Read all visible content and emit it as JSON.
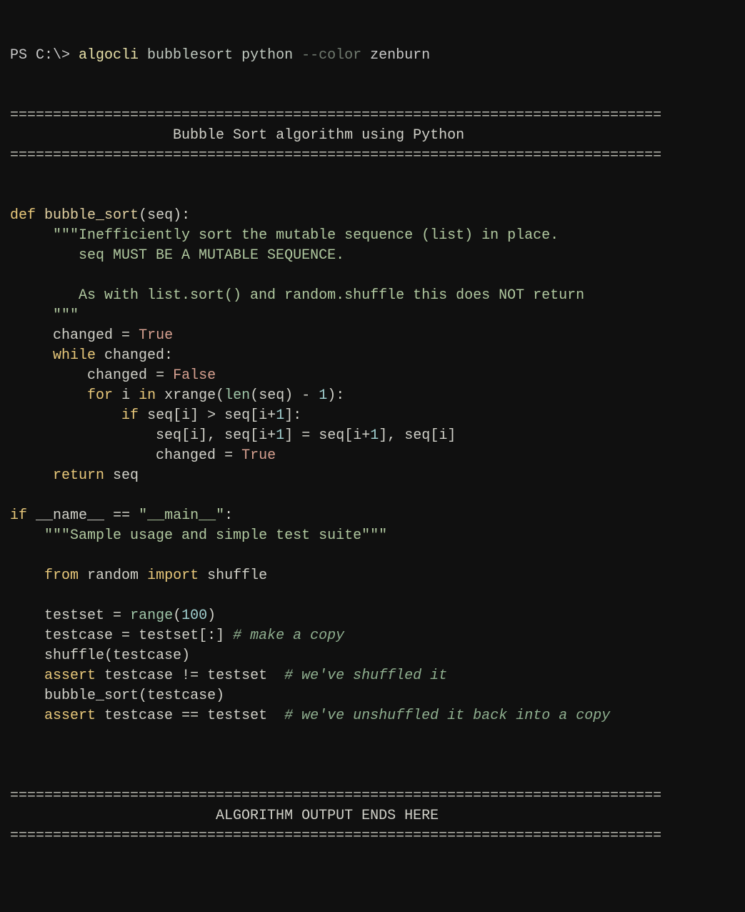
{
  "prompt": "PS C:\\> ",
  "cmd": "algocli",
  "arg1": "bubblesort",
  "arg2": "python",
  "flag": "--color",
  "flagval": "zenburn",
  "rule1": "============================================================================",
  "title": "Bubble Sort algorithm using Python",
  "rule2": "============================================================================",
  "code": {
    "def": "def",
    "fname": "bubble_sort",
    "param": "seq",
    "doc1": "\"\"\"Inefficiently sort the mutable sequence (list) in place.",
    "doc2": "seq MUST BE A MUTABLE SEQUENCE.",
    "doc3": "As with list.sort() and random.shuffle this does NOT return",
    "doc4": "\"\"\"",
    "l1a": "changed",
    "l1b": "=",
    "l1c": "True",
    "l2a": "while",
    "l2b": "changed:",
    "l3a": "changed",
    "l3b": "=",
    "l3c": "False",
    "l4a": "for",
    "l4b": "i",
    "l4c": "in",
    "l4d": "xrange",
    "l4e": "len",
    "l4f": "seq",
    "l4g": "1",
    "l5a": "if",
    "l5b": "seq",
    "l5c": "i",
    "l5d": "seq",
    "l5e": "i",
    "l5f": "1",
    "l6a": "seq",
    "l6b": "i",
    "l6c": "seq",
    "l6d": "i",
    "l6e": "1",
    "l6f": "seq",
    "l6g": "i",
    "l6h": "1",
    "l6i": "seq",
    "l6j": "i",
    "l7a": "changed",
    "l7b": "=",
    "l7c": "True",
    "l8a": "return",
    "l8b": "seq",
    "m1a": "if",
    "m1b": "__name__",
    "m1c": "==",
    "m1d": "\"__main__\"",
    "m2": "\"\"\"Sample usage and simple test suite\"\"\"",
    "m3a": "from",
    "m3b": "random",
    "m3c": "import",
    "m3d": "shuffle",
    "m4a": "testset",
    "m4b": "=",
    "m4c": "range",
    "m4d": "100",
    "m5a": "testcase",
    "m5b": "=",
    "m5c": "testset",
    "m5d": "# make a copy",
    "m6a": "shuffle",
    "m6b": "testcase",
    "m7a": "assert",
    "m7b": "testcase",
    "m7c": "!=",
    "m7d": "testset",
    "m7e": "# we've shuffled it",
    "m8a": "bubble_sort",
    "m8b": "testcase",
    "m9a": "assert",
    "m9b": "testcase",
    "m9c": "==",
    "m9d": "testset",
    "m9e": "# we've unshuffled it back into a copy"
  },
  "rule3": "============================================================================",
  "endtitle": "ALGORITHM OUTPUT ENDS HERE",
  "rule4": "============================================================================"
}
